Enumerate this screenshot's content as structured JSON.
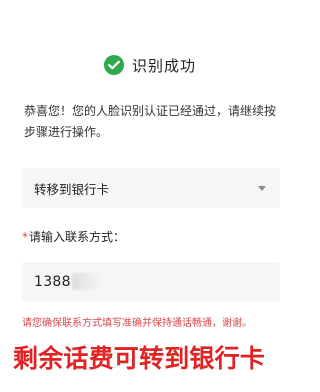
{
  "success_panel": {
    "title": "识别成功",
    "message": "恭喜您！您的人脸识别认证已经通过，请继续按步骤进行操作。"
  },
  "form": {
    "selected_option": "转移到银行卡",
    "contact_label_star": "*",
    "contact_label": "请输入联系方式：",
    "phone_value": "1388",
    "hint": "请您确保联系方式填写准确并保持通话畅通，谢谢。"
  },
  "caption": "剩余话费可转到银行卡",
  "colors": {
    "success_green": "#2ea94b",
    "hint_red": "#d8474f",
    "caption_red": "#e02323",
    "field_bg": "#f6f6f6"
  },
  "icons": {
    "success": "check-circle-icon",
    "dropdown": "caret-down-icon"
  }
}
